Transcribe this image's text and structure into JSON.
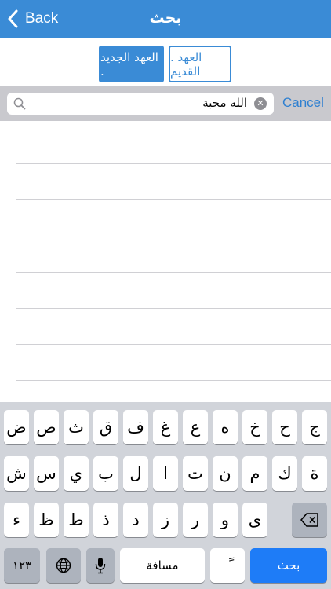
{
  "nav": {
    "back_label": "Back",
    "title": "بحث"
  },
  "segments": {
    "new_testament": "العهد الجديد .",
    "old_testament": ". العهد القديم"
  },
  "search": {
    "query": "الله محبة",
    "cancel_label": "Cancel"
  },
  "keyboard": {
    "row1": [
      "ج",
      "ح",
      "خ",
      "ه",
      "ع",
      "غ",
      "ف",
      "ق",
      "ث",
      "ص",
      "ض"
    ],
    "row2": [
      "ة",
      "ك",
      "م",
      "ن",
      "ت",
      "ا",
      "ل",
      "ب",
      "ي",
      "س",
      "ش"
    ],
    "row3": [
      "ى",
      "و",
      "ر",
      "ز",
      "د",
      "ذ",
      "ط",
      "ظ",
      "ء"
    ],
    "numbers_label": "١٢٣",
    "space_label": "مسافة",
    "diacritic_label": "ً",
    "return_label": "بحث"
  },
  "colors": {
    "accent": "#3a8bd6",
    "return_key": "#1e7cf7"
  }
}
